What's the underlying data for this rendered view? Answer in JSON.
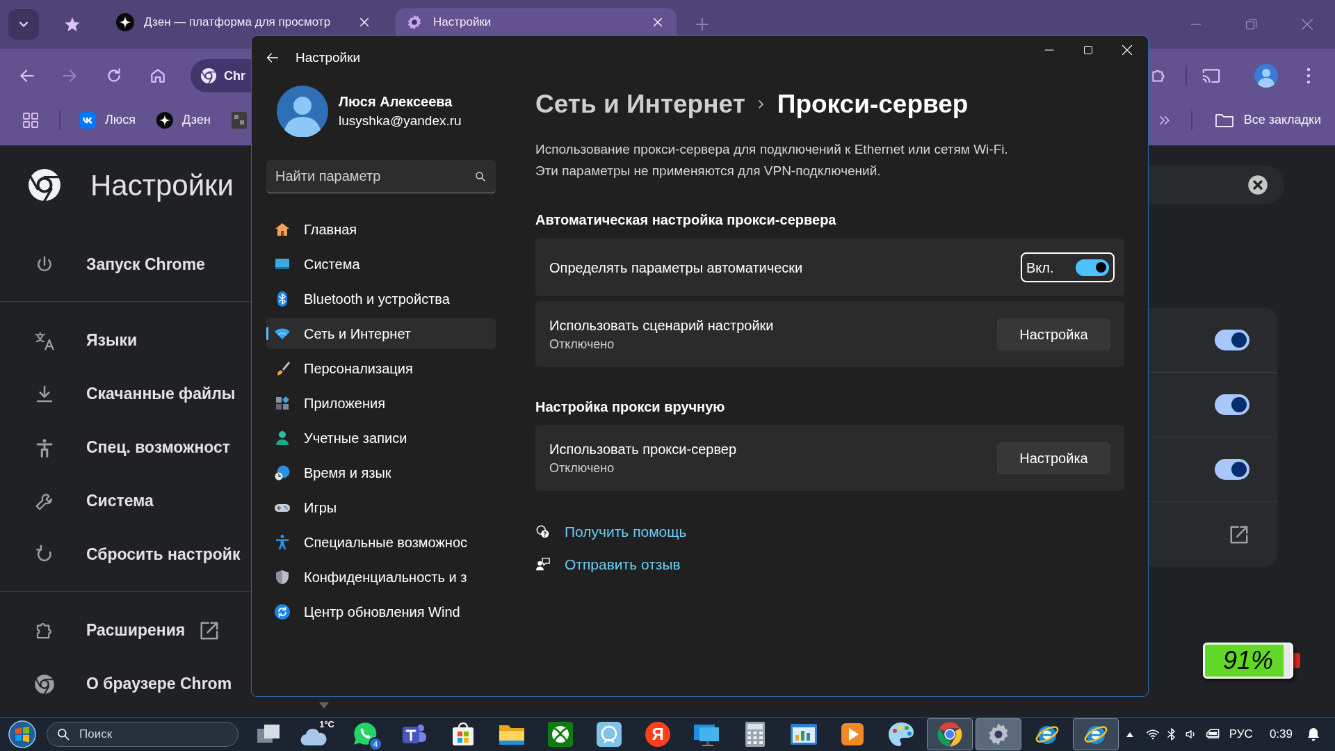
{
  "browser": {
    "tabs": [
      {
        "kind": "dzen",
        "title": "Дзен — платформа для просмотр",
        "selected": false
      },
      {
        "kind": "settings",
        "title": "Настройки",
        "selected": true
      }
    ],
    "omnibox": {
      "text": "Chr"
    },
    "bookmarks": [
      {
        "kind": "vk",
        "label": "Люся"
      },
      {
        "kind": "dzen",
        "label": "Дзен"
      },
      {
        "kind": "page"
      }
    ],
    "all_bookmarks": "Все закладки",
    "page": {
      "title": "Настройки",
      "nav_groups": [
        [
          {
            "kind": "power",
            "label": "Запуск Chrome"
          }
        ],
        [
          {
            "kind": "translate",
            "label": "Языки"
          },
          {
            "kind": "download",
            "label": "Скачанные файлы"
          },
          {
            "kind": "accessibility",
            "label": "Спец. возможност"
          },
          {
            "kind": "wrench",
            "label": "Система"
          },
          {
            "kind": "reset",
            "label": "Сбросить настройк"
          }
        ],
        [
          {
            "kind": "extension",
            "label": "Расширения"
          },
          {
            "kind": "chrome",
            "label": "О браузере Chrom"
          }
        ]
      ],
      "card_rows": [
        {
          "kind": "toggle",
          "on": true
        },
        {
          "kind": "toggle",
          "on": true
        },
        {
          "kind": "toggle",
          "on": true
        },
        {
          "kind": "external"
        }
      ]
    }
  },
  "settings_window": {
    "title": "Настройки",
    "user": {
      "name": "Люся Алексеева",
      "email": "lusyshka@yandex.ru"
    },
    "search": {
      "placeholder": "Найти параметр"
    },
    "nav": [
      {
        "kind": "home",
        "label": "Главная",
        "selected": false
      },
      {
        "kind": "system",
        "label": "Система",
        "selected": false
      },
      {
        "kind": "bluetooth",
        "label": "Bluetooth и устройства",
        "selected": false
      },
      {
        "kind": "network",
        "label": "Сеть и Интернет",
        "selected": true
      },
      {
        "kind": "brush",
        "label": "Персонализация",
        "selected": false
      },
      {
        "kind": "apps",
        "label": "Приложения",
        "selected": false
      },
      {
        "kind": "accounts",
        "label": "Учетные записи",
        "selected": false
      },
      {
        "kind": "time",
        "label": "Время и язык",
        "selected": false
      },
      {
        "kind": "games",
        "label": "Игры",
        "selected": false
      },
      {
        "kind": "accessibility",
        "label": "Специальные возможнос",
        "selected": false
      },
      {
        "kind": "privacy",
        "label": "Конфиденциальность и з",
        "selected": false
      },
      {
        "kind": "update",
        "label": "Центр обновления Wind",
        "selected": false
      }
    ],
    "breadcrumb": {
      "parent": "Сеть и Интернет",
      "current": "Прокси-сервер"
    },
    "description": "Использование прокси-сервера для подключений к Ethernet или сетям Wi-Fi.\nЭти параметры не применяются для VPN-подключений.",
    "sections": [
      {
        "heading": "Автоматическая настройка прокси-сервера",
        "rows": [
          {
            "kind": "toggle",
            "label": "Определять параметры автоматически",
            "state_text": "Вкл.",
            "on": true
          },
          {
            "kind": "button",
            "label": "Использовать сценарий настройки",
            "status": "Отключено",
            "button": "Настройка"
          }
        ]
      },
      {
        "heading": "Настройка прокси вручную",
        "rows": [
          {
            "kind": "button",
            "label": "Использовать прокси-сервер",
            "status": "Отключено",
            "button": "Настройка"
          }
        ]
      }
    ],
    "links": [
      {
        "kind": "help",
        "label": "Получить помощь"
      },
      {
        "kind": "feedback",
        "label": "Отправить отзыв"
      }
    ]
  },
  "battery_gadget": {
    "reading": "91%",
    "level": 0.91
  },
  "taskbar": {
    "search": {
      "placeholder": "Поиск"
    },
    "apps": [
      {
        "kind": "taskview",
        "open": false,
        "selected": false
      },
      {
        "kind": "weather",
        "label": "1°C",
        "open": false,
        "selected": false
      },
      {
        "kind": "whatsapp",
        "badge": "4",
        "open": false,
        "selected": false
      },
      {
        "kind": "teams",
        "open": false,
        "selected": false
      },
      {
        "kind": "store",
        "open": false,
        "selected": false
      },
      {
        "kind": "explorer",
        "open": false,
        "selected": false
      },
      {
        "kind": "xbox",
        "open": false,
        "selected": false
      },
      {
        "kind": "app",
        "open": false,
        "selected": false
      },
      {
        "kind": "yandex",
        "label": "Я",
        "open": false,
        "selected": false
      },
      {
        "kind": "display",
        "open": false,
        "selected": false
      },
      {
        "kind": "calculator",
        "open": false,
        "selected": false
      },
      {
        "kind": "controlpanel",
        "open": false,
        "selected": false
      },
      {
        "kind": "media",
        "open": false,
        "selected": false
      },
      {
        "kind": "paint",
        "open": false,
        "selected": false
      },
      {
        "kind": "chrome",
        "open": true,
        "selected": false
      },
      {
        "kind": "settings",
        "open": true,
        "selected": true
      },
      {
        "kind": "ie",
        "open": false,
        "selected": false
      },
      {
        "kind": "ie",
        "open": true,
        "selected": false
      }
    ],
    "language": "РУС",
    "time": "0:39"
  }
}
